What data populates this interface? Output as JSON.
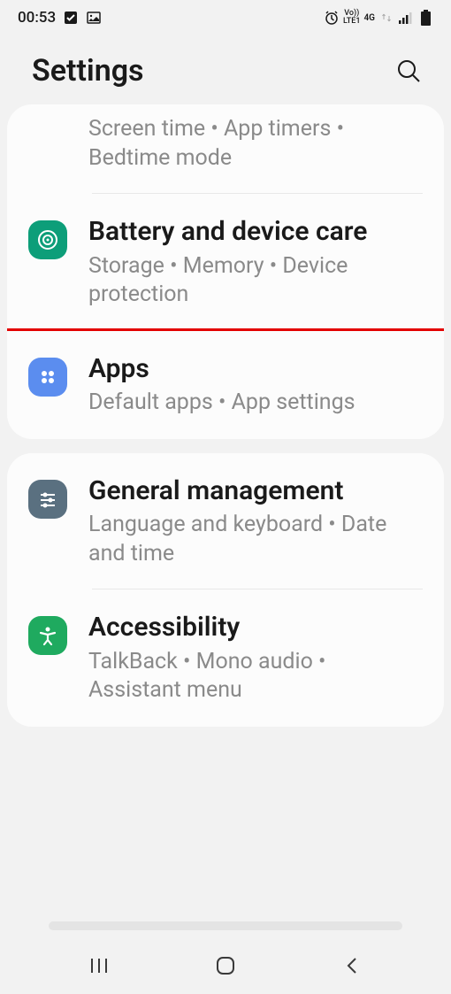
{
  "status": {
    "time": "00:53",
    "network": "4G",
    "carrier": "LTE1",
    "volte": "Vo))"
  },
  "header": {
    "title": "Settings"
  },
  "items": {
    "screen_time": {
      "subtitle": "Screen time  •  App timers  •  Bedtime mode"
    },
    "battery": {
      "title": "Battery and device care",
      "subtitle": "Storage  •  Memory  •  Device protection"
    },
    "apps": {
      "title": "Apps",
      "subtitle": "Default apps  •  App settings"
    },
    "general": {
      "title": "General management",
      "subtitle": "Language and keyboard  •  Date and time"
    },
    "accessibility": {
      "title": "Accessibility",
      "subtitle": "TalkBack  •  Mono audio  •  Assistant menu"
    }
  },
  "colors": {
    "battery_icon": "#0d9e79",
    "apps_icon": "#5b8def",
    "general_icon": "#5a7080",
    "accessibility_icon": "#1faa5f"
  }
}
